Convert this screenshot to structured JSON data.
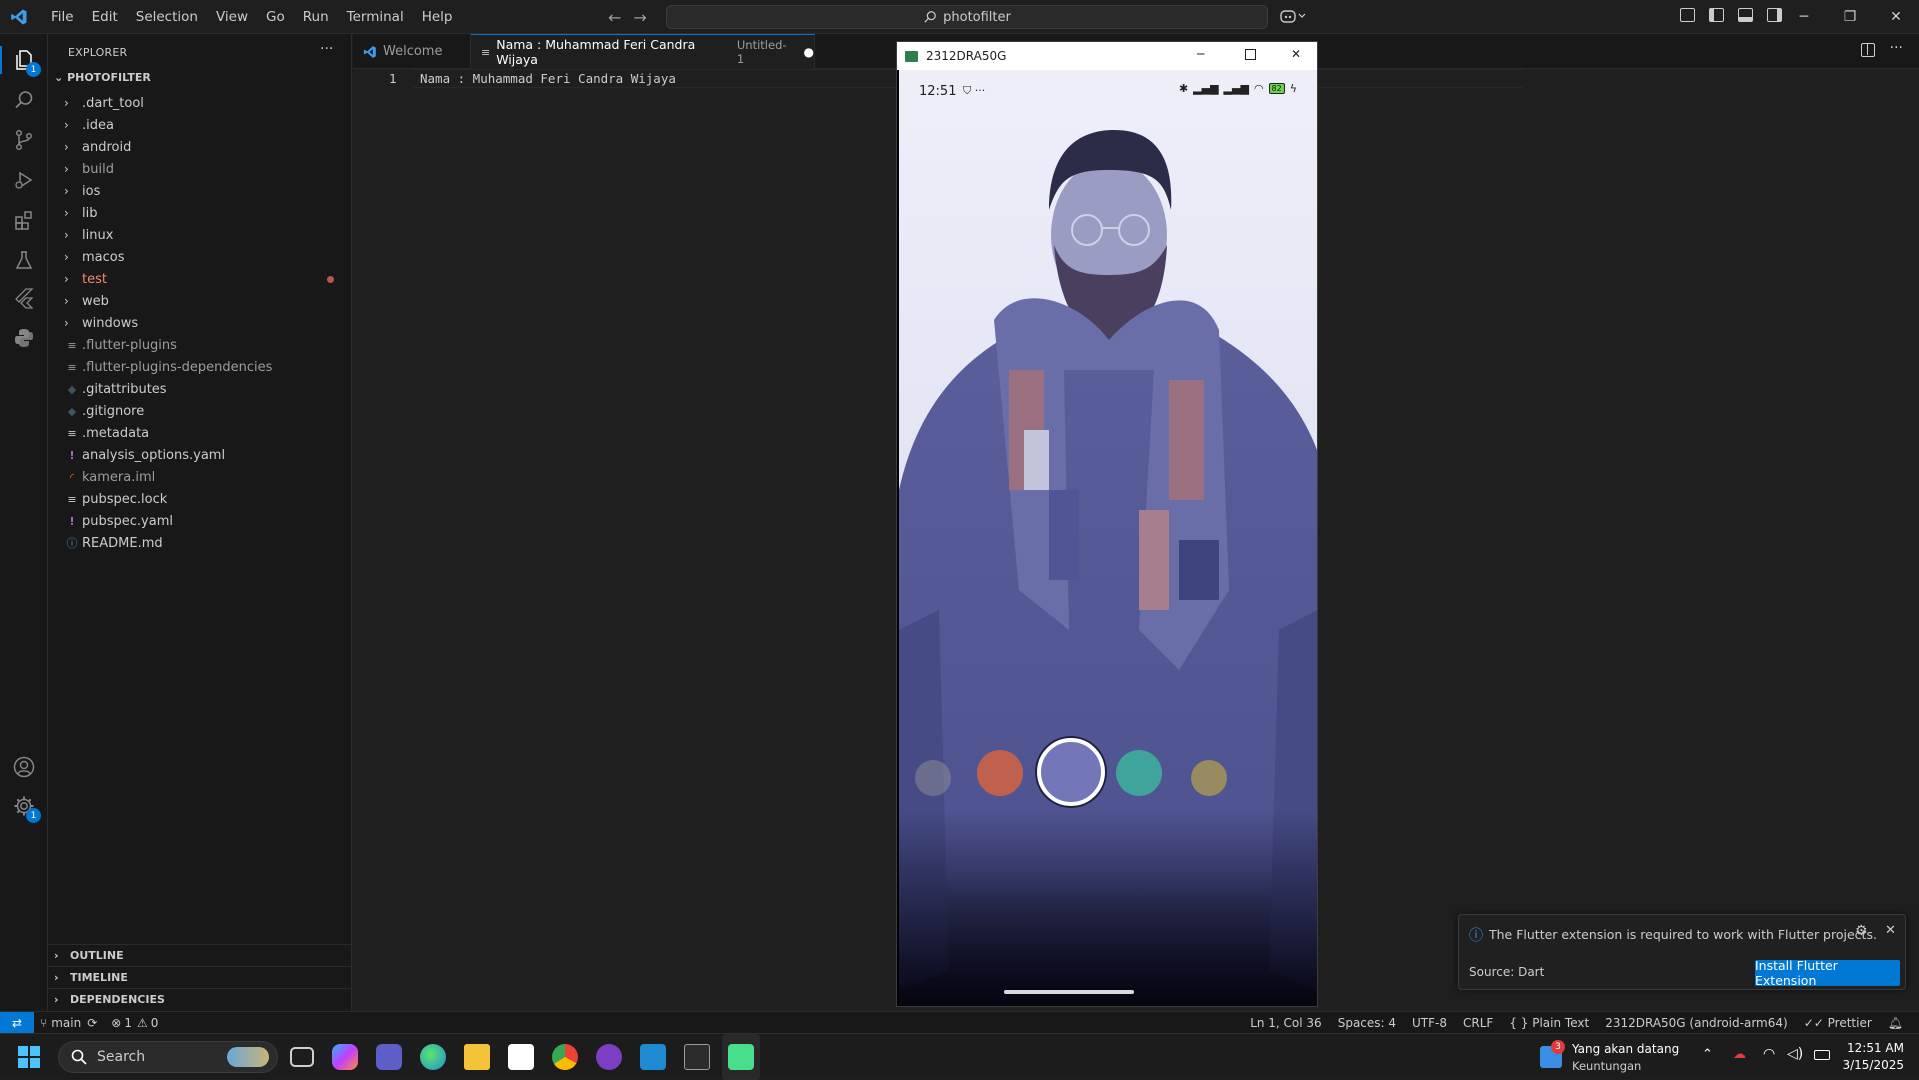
{
  "titlebar": {
    "menu": [
      "File",
      "Edit",
      "Selection",
      "View",
      "Go",
      "Run",
      "Terminal",
      "Help"
    ],
    "search_text": "photofilter"
  },
  "activity": {
    "explorer_badge": "1",
    "settings_badge": "1"
  },
  "explorer": {
    "title": "EXPLORER",
    "root": "PHOTOFILTER",
    "folders": [
      ".dart_tool",
      ".idea",
      "android",
      "build",
      "ios",
      "lib",
      "linux",
      "macos",
      "test",
      "web",
      "windows"
    ],
    "files": [
      {
        "name": ".flutter-plugins",
        "icon": "lines-icon",
        "color": "#9d9d9d"
      },
      {
        "name": ".flutter-plugins-dependencies",
        "icon": "lines-icon",
        "color": "#9d9d9d"
      },
      {
        "name": ".gitattributes",
        "icon": "git-icon",
        "color": "#cccccc"
      },
      {
        "name": ".gitignore",
        "icon": "git-icon",
        "color": "#cccccc"
      },
      {
        "name": ".metadata",
        "icon": "lines-icon",
        "color": "#cccccc"
      },
      {
        "name": "analysis_options.yaml",
        "icon": "exclamation-icon",
        "color": "#cccccc"
      },
      {
        "name": "kamera.iml",
        "icon": "rss-icon",
        "color": "#9d9d9d"
      },
      {
        "name": "pubspec.lock",
        "icon": "lines-icon",
        "color": "#cccccc"
      },
      {
        "name": "pubspec.yaml",
        "icon": "exclamation-icon",
        "color": "#cccccc"
      },
      {
        "name": "README.md",
        "icon": "info-icon",
        "color": "#cccccc"
      }
    ],
    "sections": [
      "OUTLINE",
      "TIMELINE",
      "DEPENDENCIES"
    ]
  },
  "tabs": {
    "welcome": "Welcome",
    "active_title": "Nama : Muhammad Feri Candra Wijaya",
    "active_desc": "Untitled-1"
  },
  "editor": {
    "line_number": "1",
    "line_text": "Nama : Muhammad Feri Candra Wijaya"
  },
  "phone": {
    "window_title": "2312DRA50G",
    "time": "12:51",
    "battery": "82",
    "filter_colors": [
      "#8a8b93",
      "#c0604f",
      "#7376b8",
      "#3fa49b",
      "#b7a24a"
    ],
    "selected_filter_index": 2
  },
  "notification": {
    "message": "The Flutter extension is required to work with Flutter projects.",
    "source": "Source: Dart",
    "button": "Install Flutter Extension"
  },
  "statusbar": {
    "branch": "main",
    "errors": "1",
    "warnings": "0",
    "position": "Ln 1, Col 36",
    "spaces": "Spaces: 4",
    "encoding": "UTF-8",
    "eol": "CRLF",
    "language": "Plain Text",
    "device": "2312DRA50G (android-arm64)",
    "prettier": "Prettier"
  },
  "taskbar": {
    "search": "Search",
    "weather_title": "Yang akan datang",
    "weather_sub": "Keuntungan",
    "weather_badge": "3",
    "time": "12:51 AM",
    "date": "3/15/2025"
  }
}
